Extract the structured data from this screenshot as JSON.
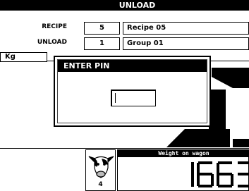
{
  "header": {
    "title": "UNLOAD"
  },
  "fields": [
    {
      "label": "RECIPE",
      "number": "5",
      "value": "Recipe 05"
    },
    {
      "label": "UNLOAD",
      "number": "1",
      "value": "Group 01"
    }
  ],
  "scale": {
    "unit": "Kg"
  },
  "dialog": {
    "title": "ENTER PIN",
    "pin_value": ""
  },
  "cow_panel": {
    "icon": "cow-head-icon",
    "count": "4"
  },
  "weight_panel": {
    "title": "Weight on wagon",
    "value": "1663"
  },
  "colors": {
    "foreground": "#000000",
    "background": "#ffffff"
  }
}
